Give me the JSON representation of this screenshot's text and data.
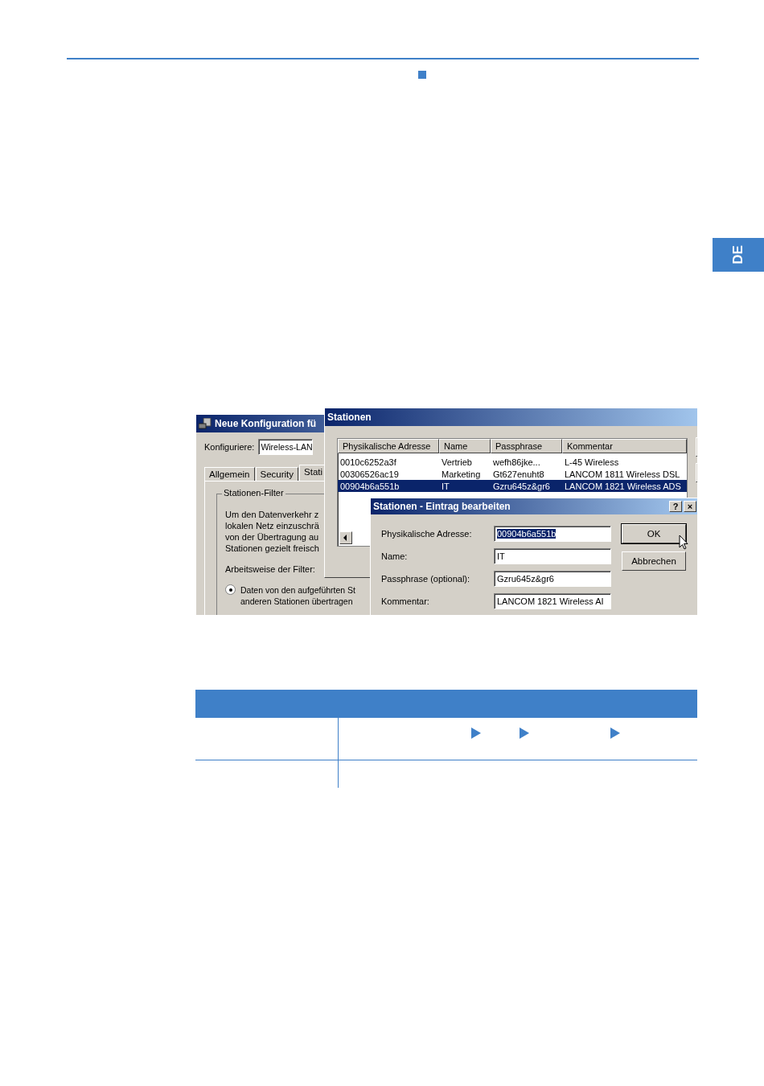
{
  "side_tab": {
    "label": "DE"
  },
  "screenshot": {
    "config_window": {
      "title": "Neue Konfiguration fü",
      "configure_label": "Konfiguriere:",
      "configure_value": "Wireless-LAN",
      "tabs": [
        {
          "label": "Allgemein",
          "selected": false
        },
        {
          "label": "Security",
          "selected": false
        },
        {
          "label": "Stati",
          "selected": true
        }
      ],
      "group_title": "Stationen-Filter",
      "description_lines": [
        "Um den Datenverkehr z",
        "lokalen Netz einzuschrä",
        "von der Übertragung au",
        "Stationen gezielt freisch"
      ],
      "mode_label": "Arbeitsweise der Filter:",
      "radio": {
        "lines": [
          "Daten von den aufgeführten St",
          "anderen Stationen übertragen"
        ],
        "checked": true
      }
    },
    "stations_window": {
      "title": "Stationen",
      "columns": [
        "Physikalische Adresse",
        "Name",
        "Passphrase",
        "Kommentar"
      ],
      "rows": [
        {
          "cells": [
            "0010c6252a3f",
            "Vertrieb",
            "wefh86jke...",
            "L-45 Wireless"
          ],
          "selected": false
        },
        {
          "cells": [
            "00306526ac19",
            "Marketing",
            "Gt627enuht8",
            "LANCOM 1811 Wireless DSL"
          ],
          "selected": false
        },
        {
          "cells": [
            "00904b6a551b",
            "IT",
            "Gzru645z&gr6",
            "LANCOM 1821 Wireless ADS"
          ],
          "selected": true
        }
      ]
    },
    "edit_dialog": {
      "title": "Stationen - Eintrag bearbeiten",
      "help": "?",
      "close": "×",
      "fields": [
        {
          "label": "Physikalische Adresse:",
          "value": "00904b6a551b",
          "highlighted": true
        },
        {
          "label": "Name:",
          "value": "IT",
          "highlighted": false
        },
        {
          "label": "Passphrase (optional):",
          "value": "Gzru645z&gr6",
          "highlighted": false
        },
        {
          "label": "Kommentar:",
          "value": "LANCOM 1821 Wireless AI",
          "highlighted": false
        }
      ],
      "buttons": [
        "OK",
        "Abbrechen"
      ]
    }
  }
}
